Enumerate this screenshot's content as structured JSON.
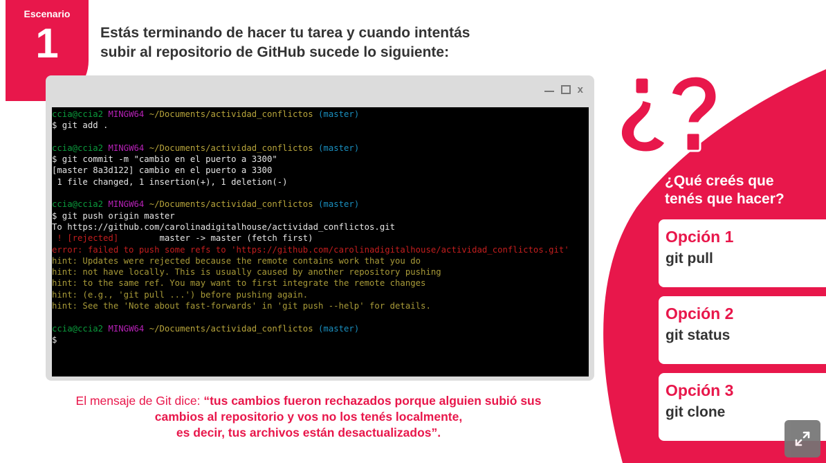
{
  "scenario": {
    "label": "Escenario",
    "number": "1"
  },
  "heading": {
    "line1": "Estás terminando de hacer tu tarea y cuando intentás",
    "line2": "subir al repositorio de GitHub sucede lo siguiente:"
  },
  "window_controls": {
    "close": "x"
  },
  "terminal": {
    "prompt": {
      "user": "ccia@ccia2",
      "shell": "MINGW64",
      "path": "~/Documents/actividad_conflictos",
      "branch": "(master)"
    },
    "lines": {
      "cmd1": "$ git add .",
      "cmd2": "$ git commit -m \"cambio en el puerto a 3300\"",
      "out2a": "[master 8a3d122] cambio en el puerto a 3300",
      "out2b": " 1 file changed, 1 insertion(+), 1 deletion(-)",
      "cmd3": "$ git push origin master",
      "out3a": "To https://github.com/carolinadigitalhouse/actividad_conflictos.git",
      "rejected_tag": " ! [rejected]",
      "rejected_rest": "        master -> master (fetch first)",
      "error": "error: failed to push some refs to 'https://github.com/carolinadigitalhouse/actividad_conflictos.git'",
      "hint1": "hint: Updates were rejected because the remote contains work that you do",
      "hint2": "hint: not have locally. This is usually caused by another repository pushing",
      "hint3": "hint: to the same ref. You may want to first integrate the remote changes",
      "hint4": "hint: (e.g., 'git pull ...') before pushing again.",
      "hint5": "hint: See the 'Note about fast-forwards' in 'git push --help' for details.",
      "cmd4": "$"
    }
  },
  "git_message": {
    "prefix": "El mensaje de Git dice: ",
    "line1": "“tus cambios fueron rechazados porque alguien subió sus",
    "line2": "cambios al repositorio y vos no los tenés localmente,",
    "line3": "es decir, tus archivos están desactualizados”."
  },
  "panel": {
    "question_line1": "¿Qué creés que",
    "question_line2": "tenés que hacer?",
    "options": [
      {
        "title": "Opción 1",
        "value": "git pull"
      },
      {
        "title": "Opción 2",
        "value": "git status"
      },
      {
        "title": "Opción 3",
        "value": "git clone"
      }
    ]
  },
  "colors": {
    "accent": "#e8174b",
    "terminal_bg": "#000000",
    "window_frame": "#dcdcdc"
  },
  "icons": {
    "expand": "expand-arrows-icon",
    "question_marks": "question-marks-graphic"
  }
}
